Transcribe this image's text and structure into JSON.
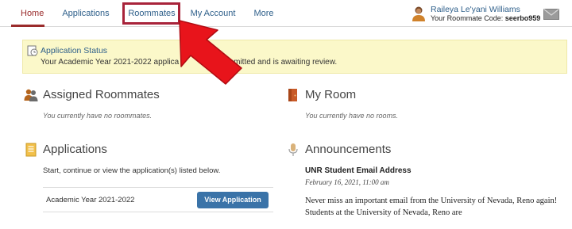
{
  "nav": {
    "tabs": [
      {
        "label": "Home",
        "active": true
      },
      {
        "label": "Applications"
      },
      {
        "label": "Roommates"
      },
      {
        "label": "My Account"
      },
      {
        "label": "More"
      }
    ]
  },
  "user": {
    "name": "Raileya Le'yani Williams",
    "code_label": "Your Roommate Code:",
    "code": "seerbo959"
  },
  "status": {
    "title": "Application Status",
    "text_start": "Your Academic Year 2021-2022 applica",
    "text_end": "ubmitted and is awaiting review."
  },
  "assigned_roommates": {
    "title": "Assigned Roommates",
    "empty": "You currently have no roommates."
  },
  "my_room": {
    "title": "My Room",
    "empty": "You currently have no rooms."
  },
  "applications": {
    "title": "Applications",
    "intro": "Start, continue or view the application(s) listed below.",
    "items": [
      {
        "name": "Academic Year 2021-2022",
        "button": "View Application"
      }
    ]
  },
  "announcements": {
    "title": "Announcements",
    "headline": "UNR Student Email Address",
    "date": "February 16, 2021, 11:00 am",
    "body": "Never miss an important email from the University of Nevada, Reno again! Students at the University of Nevada, Reno are"
  },
  "colors": {
    "accent": "#9a2b2b",
    "link": "#2e5f8a",
    "banner": "#fbf8c9",
    "button": "#3a73a8",
    "annotation": "#e8141b"
  }
}
